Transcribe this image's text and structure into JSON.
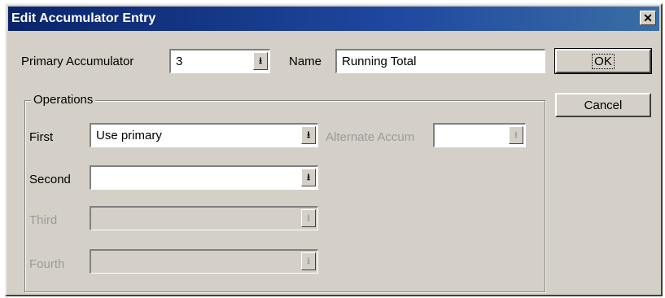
{
  "window": {
    "title": "Edit Accumulator Entry",
    "close_glyph": "✕"
  },
  "primary": {
    "label": "Primary Accumulator",
    "value": "3"
  },
  "name": {
    "label": "Name",
    "value": "Running Total"
  },
  "operations": {
    "legend": "Operations",
    "first": {
      "label": "First",
      "value": "Use primary"
    },
    "second": {
      "label": "Second",
      "value": ""
    },
    "third": {
      "label": "Third",
      "value": ""
    },
    "fourth": {
      "label": "Fourth",
      "value": ""
    },
    "alternate": {
      "label": "Alternate Accum",
      "value": ""
    }
  },
  "buttons": {
    "ok": "OK",
    "cancel": "Cancel"
  },
  "icons": {
    "dropdown_arrow": "dropdown-arrow-icon"
  }
}
